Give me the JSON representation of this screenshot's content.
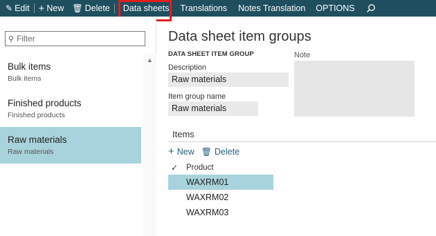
{
  "actionbar": {
    "edit": {
      "label": "Edit",
      "icon": "pencil-icon"
    },
    "new": {
      "label": "New",
      "icon": "plus-icon"
    },
    "delete": {
      "label": "Delete",
      "icon": "trash-icon"
    },
    "data_sheets": "Data sheets",
    "translations": "Translations",
    "notes_translation": "Notes Translation",
    "options": "OPTIONS",
    "search_icon": "search-icon",
    "highlight_color": "#e41c1c",
    "bg_color": "#1f4e5f"
  },
  "sidebar": {
    "filter_placeholder": "Filter",
    "items": [
      {
        "title": "Bulk items",
        "subtitle": "Bulk items",
        "selected": false
      },
      {
        "title": "Finished products",
        "subtitle": "Finished products",
        "selected": false
      },
      {
        "title": "Raw materials",
        "subtitle": "Raw materials",
        "selected": true
      }
    ],
    "selected_color": "#a9d3dc"
  },
  "main": {
    "title": "Data sheet item groups",
    "group_header": "DATA SHEET ITEM GROUP",
    "description_label": "Description",
    "description_value": "Raw materials",
    "item_group_name_label": "Item group name",
    "item_group_name_value": "Raw materials",
    "note_label": "Note",
    "items": {
      "title": "Items",
      "new_label": "New",
      "delete_label": "Delete",
      "column_header": "Product",
      "rows": [
        "WAXRM01",
        "WAXRM02",
        "WAXRM03"
      ],
      "selected_index": 0
    }
  }
}
